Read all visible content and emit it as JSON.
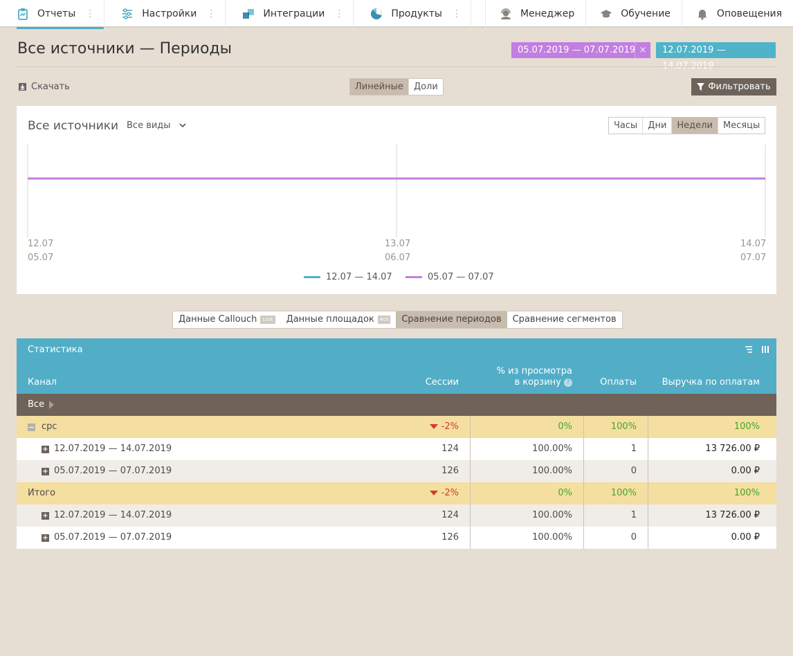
{
  "nav": {
    "items": [
      {
        "label": "Отчеты",
        "icon": "clipboard-icon"
      },
      {
        "label": "Настройки",
        "icon": "sliders-icon"
      },
      {
        "label": "Интеграции",
        "icon": "puzzle-icon"
      },
      {
        "label": "Продукты",
        "icon": "pie-icon"
      }
    ],
    "right": [
      {
        "label": "Менеджер",
        "icon": "headset-icon"
      },
      {
        "label": "Обучение",
        "icon": "graduation-cap-icon"
      },
      {
        "label": "Оповещения",
        "icon": "bell-icon"
      }
    ]
  },
  "header": {
    "title": "Все источники — Периоды",
    "period1": "05.07.2019 — 07.07.2019",
    "period1_close": "×",
    "period2": "12.07.2019 — 14.07.2019"
  },
  "toolbar": {
    "download": "Скачать",
    "chart_type": [
      "Линейные",
      "Доли"
    ],
    "chart_type_selected": "Линейные",
    "filter": "Фильтровать"
  },
  "chart_card": {
    "title": "Все источники",
    "view_select": "Все виды",
    "granularity": [
      "Часы",
      "Дни",
      "Недели",
      "Месяцы"
    ],
    "granularity_selected": "Недели"
  },
  "chart_data": {
    "type": "line",
    "x": [
      "12.07",
      "13.07",
      "14.07"
    ],
    "x_secondary": [
      "05.07",
      "06.07",
      "07.07"
    ],
    "series": [
      {
        "name": "12.07 — 14.07",
        "color": "#4fb3c9",
        "values": [
          1,
          1,
          1
        ]
      },
      {
        "name": "05.07 — 07.07",
        "color": "#c27ee0",
        "values": [
          1,
          1,
          1
        ]
      }
    ],
    "grid": "vertical",
    "legend": "bottom-center"
  },
  "tabs": [
    {
      "label": "Данные Callouch",
      "tag": "LIVE"
    },
    {
      "label": "Данные площадок",
      "tag": "ROI"
    },
    {
      "label": "Сравнение периодов",
      "tag": ""
    },
    {
      "label": "Сравнение сегментов",
      "tag": ""
    }
  ],
  "table": {
    "title": "Статистика",
    "columns": {
      "channel": "Канал",
      "sessions": "Сессии",
      "cart_line1": "% из просмотра",
      "cart_line2": "в корзину",
      "payments": "Оплаты",
      "revenue": "Выручка по оплатам"
    },
    "all_label": "Все",
    "groups": [
      {
        "label": "cpc",
        "sessions": "-2%",
        "cart": "0%",
        "payments": "100%",
        "revenue": "100%",
        "rows": [
          {
            "label": "12.07.2019 — 14.07.2019",
            "sessions": "124",
            "cart": "100.00%",
            "payments": "1",
            "revenue": "13 726.00 ₽"
          },
          {
            "label": "05.07.2019 — 07.07.2019",
            "sessions": "126",
            "cart": "100.00%",
            "payments": "0",
            "revenue": "0.00 ₽"
          }
        ]
      },
      {
        "label": "Итого",
        "sessions": "-2%",
        "cart": "0%",
        "payments": "100%",
        "revenue": "100%",
        "rows": [
          {
            "label": "12.07.2019 — 14.07.2019",
            "sessions": "124",
            "cart": "100.00%",
            "payments": "1",
            "revenue": "13 726.00 ₽"
          },
          {
            "label": "05.07.2019 — 07.07.2019",
            "sessions": "126",
            "cart": "100.00%",
            "payments": "0",
            "revenue": "0.00 ₽"
          }
        ]
      }
    ]
  }
}
